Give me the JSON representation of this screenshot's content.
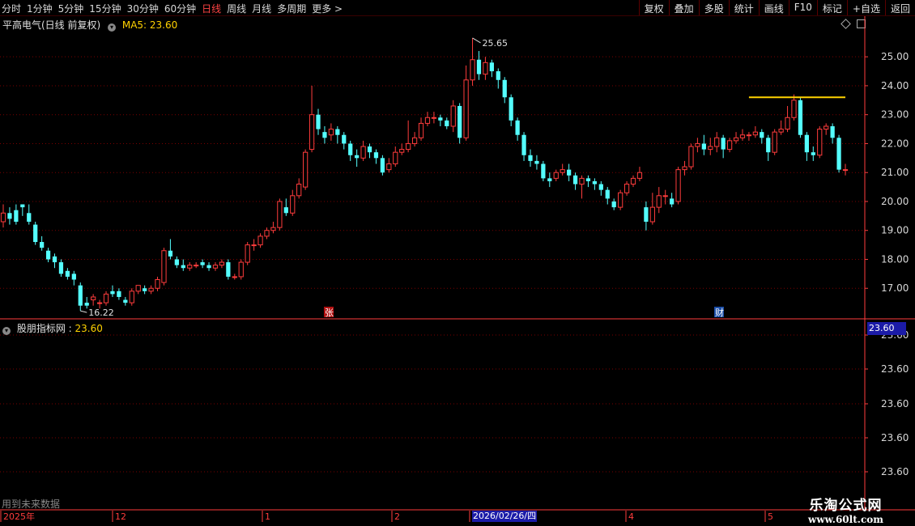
{
  "toolbar": {
    "periods": [
      "分时",
      "1分钟",
      "5分钟",
      "15分钟",
      "30分钟",
      "60分钟",
      "日线",
      "周线",
      "月线",
      "多周期",
      "更多 >"
    ],
    "active_period": "日线",
    "actions": [
      "复权",
      "叠加",
      "多股",
      "统计",
      "画线",
      "F10",
      "标记",
      "+自选",
      "返回"
    ]
  },
  "stock": {
    "name": "平高电气(日线 前复权)",
    "ma_label": "MA5: 23.60"
  },
  "indicator": {
    "name": "股朋指标网 :",
    "value": "23.60",
    "axis_labels": [
      "23.60",
      "23.60",
      "23.60",
      "23.60",
      "23.60"
    ],
    "current_tag": "23.60"
  },
  "note": "用到未来数据",
  "date_axis": {
    "labels": [
      "2025年",
      "12",
      "1",
      "2",
      "2026/02/26/四",
      "4",
      "5"
    ]
  },
  "markers": {
    "zhang": "张",
    "cai": "财"
  },
  "watermark": {
    "line1": "乐淘公式网",
    "line2": "www.60lt.com"
  },
  "colors": {
    "up": "#ff3c3c",
    "down": "#54ffff",
    "ma": "#ffd200",
    "grid": "#7a0000",
    "axis": "#ff3c3c"
  },
  "chart_data": {
    "type": "candlestick",
    "price_axis": {
      "ticks": [
        17.0,
        18.0,
        19.0,
        20.0,
        21.0,
        22.0,
        23.0,
        24.0,
        25.0
      ],
      "ylim": [
        16.0,
        25.9
      ]
    },
    "annotations": {
      "high_label": "25.65",
      "low_label": "16.22"
    },
    "ma5_level": 23.6,
    "candles": [
      [
        19.3,
        19.6,
        19.9,
        19.1
      ],
      [
        19.6,
        19.4,
        19.8,
        19.2
      ],
      [
        19.7,
        19.3,
        19.9,
        19.2
      ],
      [
        19.9,
        19.8,
        19.9,
        19.5
      ],
      [
        19.6,
        19.3,
        19.9,
        19.2
      ],
      [
        19.2,
        18.6,
        19.3,
        18.5
      ],
      [
        18.6,
        18.4,
        18.8,
        18.3
      ],
      [
        18.3,
        18.0,
        18.4,
        17.9
      ],
      [
        18.1,
        17.9,
        18.2,
        17.7
      ],
      [
        17.9,
        17.5,
        18.0,
        17.4
      ],
      [
        17.6,
        17.4,
        17.7,
        17.3
      ],
      [
        17.5,
        17.3,
        17.6,
        17.1
      ],
      [
        17.1,
        16.4,
        17.2,
        16.22
      ],
      [
        16.5,
        16.4,
        16.7,
        16.3
      ],
      [
        16.6,
        16.7,
        16.8,
        16.4
      ],
      [
        16.5,
        16.5,
        16.6,
        16.3
      ],
      [
        16.5,
        16.8,
        16.9,
        16.4
      ],
      [
        16.9,
        16.8,
        17.1,
        16.7
      ],
      [
        16.9,
        16.7,
        17.0,
        16.6
      ],
      [
        16.6,
        16.5,
        16.7,
        16.4
      ],
      [
        16.5,
        16.9,
        17.0,
        16.4
      ],
      [
        16.9,
        17.1,
        17.1,
        16.8
      ],
      [
        17.0,
        16.9,
        17.1,
        16.8
      ],
      [
        16.9,
        17.0,
        17.1,
        16.8
      ],
      [
        17.0,
        17.3,
        17.4,
        16.9
      ],
      [
        17.2,
        18.3,
        18.4,
        17.1
      ],
      [
        18.3,
        18.1,
        18.7,
        18.0
      ],
      [
        18.0,
        17.8,
        18.1,
        17.7
      ],
      [
        17.8,
        17.7,
        18.0,
        17.6
      ],
      [
        17.7,
        17.8,
        17.9,
        17.6
      ],
      [
        17.8,
        17.8,
        17.9,
        17.7
      ],
      [
        17.9,
        17.8,
        18.0,
        17.7
      ],
      [
        17.8,
        17.7,
        17.9,
        17.6
      ],
      [
        17.7,
        17.8,
        17.9,
        17.6
      ],
      [
        17.8,
        17.9,
        18.0,
        17.7
      ],
      [
        17.9,
        17.4,
        18.0,
        17.3
      ],
      [
        17.4,
        17.4,
        17.5,
        17.3
      ],
      [
        17.4,
        17.9,
        18.0,
        17.3
      ],
      [
        17.9,
        18.5,
        18.6,
        17.8
      ],
      [
        18.5,
        18.5,
        18.7,
        18.3
      ],
      [
        18.5,
        18.8,
        18.9,
        18.4
      ],
      [
        18.8,
        19.0,
        19.1,
        18.7
      ],
      [
        19.0,
        19.1,
        19.3,
        18.9
      ],
      [
        19.1,
        20.0,
        20.1,
        19.0
      ],
      [
        19.8,
        19.6,
        20.1,
        19.5
      ],
      [
        19.6,
        20.2,
        20.4,
        19.5
      ],
      [
        20.2,
        20.6,
        20.8,
        20.1
      ],
      [
        20.5,
        21.7,
        21.8,
        20.4
      ],
      [
        21.8,
        23.0,
        24.0,
        21.7
      ],
      [
        23.0,
        22.5,
        23.2,
        22.3
      ],
      [
        22.4,
        22.2,
        22.6,
        22.0
      ],
      [
        22.3,
        22.5,
        22.7,
        22.1
      ],
      [
        22.5,
        22.3,
        22.6,
        22.0
      ],
      [
        22.3,
        22.0,
        22.4,
        21.8
      ],
      [
        22.0,
        21.6,
        22.1,
        21.4
      ],
      [
        21.6,
        21.5,
        21.8,
        21.2
      ],
      [
        21.5,
        21.9,
        22.1,
        21.4
      ],
      [
        21.9,
        21.7,
        22.0,
        21.5
      ],
      [
        21.7,
        21.5,
        21.8,
        21.3
      ],
      [
        21.5,
        21.0,
        21.6,
        20.9
      ],
      [
        21.1,
        21.3,
        21.5,
        21.0
      ],
      [
        21.3,
        21.7,
        21.9,
        21.2
      ],
      [
        21.7,
        21.8,
        22.0,
        21.6
      ],
      [
        21.8,
        22.0,
        22.8,
        21.7
      ],
      [
        22.0,
        22.2,
        22.4,
        21.9
      ],
      [
        22.2,
        22.7,
        22.9,
        22.1
      ],
      [
        22.7,
        22.9,
        23.1,
        22.6
      ],
      [
        22.9,
        22.9,
        23.1,
        22.7
      ],
      [
        22.9,
        22.8,
        23.0,
        22.6
      ],
      [
        22.8,
        22.6,
        22.9,
        22.5
      ],
      [
        22.6,
        23.3,
        23.5,
        22.4
      ],
      [
        23.3,
        22.2,
        23.4,
        22.0
      ],
      [
        22.2,
        24.2,
        24.7,
        22.1
      ],
      [
        24.2,
        24.9,
        25.65,
        24.0
      ],
      [
        24.9,
        24.4,
        25.2,
        24.2
      ],
      [
        24.4,
        24.8,
        25.0,
        24.2
      ],
      [
        24.8,
        24.5,
        24.9,
        24.3
      ],
      [
        24.5,
        24.2,
        24.6,
        23.9
      ],
      [
        24.2,
        23.6,
        24.3,
        23.4
      ],
      [
        23.6,
        22.8,
        23.7,
        22.6
      ],
      [
        22.8,
        22.3,
        22.9,
        22.1
      ],
      [
        22.3,
        21.6,
        22.4,
        21.4
      ],
      [
        21.6,
        21.4,
        21.8,
        21.2
      ],
      [
        21.4,
        21.3,
        21.6,
        21.1
      ],
      [
        21.3,
        20.8,
        21.4,
        20.7
      ],
      [
        20.8,
        20.7,
        21.0,
        20.5
      ],
      [
        20.8,
        21.0,
        21.1,
        20.7
      ],
      [
        21.0,
        21.1,
        21.3,
        20.9
      ],
      [
        21.1,
        20.9,
        21.3,
        20.7
      ],
      [
        20.9,
        20.6,
        21.0,
        20.4
      ],
      [
        20.6,
        20.8,
        20.9,
        20.1
      ],
      [
        20.8,
        20.7,
        20.9,
        20.5
      ],
      [
        20.7,
        20.6,
        20.8,
        20.4
      ],
      [
        20.6,
        20.4,
        20.7,
        20.2
      ],
      [
        20.4,
        20.1,
        20.5,
        19.9
      ],
      [
        20.0,
        19.8,
        20.1,
        19.7
      ],
      [
        19.8,
        20.3,
        20.4,
        19.7
      ],
      [
        20.3,
        20.6,
        20.7,
        20.2
      ],
      [
        20.6,
        20.8,
        20.9,
        20.5
      ],
      [
        20.8,
        21.0,
        21.2,
        20.7
      ],
      [
        19.8,
        19.3,
        20.0,
        19.0
      ],
      [
        19.3,
        19.8,
        20.3,
        19.2
      ],
      [
        19.8,
        20.2,
        20.5,
        19.6
      ],
      [
        20.2,
        20.2,
        20.4,
        19.9
      ],
      [
        20.1,
        19.9,
        20.3,
        19.8
      ],
      [
        20.0,
        21.1,
        21.2,
        19.9
      ],
      [
        21.1,
        21.2,
        21.4,
        20.9
      ],
      [
        21.2,
        21.9,
        22.0,
        21.1
      ],
      [
        21.9,
        22.0,
        22.2,
        21.7
      ],
      [
        22.0,
        21.8,
        22.3,
        21.6
      ],
      [
        21.8,
        21.9,
        22.2,
        21.6
      ],
      [
        21.9,
        22.2,
        22.4,
        21.7
      ],
      [
        22.2,
        21.8,
        22.3,
        21.5
      ],
      [
        21.8,
        22.1,
        22.2,
        21.7
      ],
      [
        22.1,
        22.2,
        22.4,
        22.0
      ],
      [
        22.2,
        22.3,
        22.5,
        22.1
      ],
      [
        22.3,
        22.3,
        22.4,
        22.1
      ],
      [
        22.3,
        22.4,
        22.6,
        22.2
      ],
      [
        22.4,
        22.2,
        22.5,
        22.0
      ],
      [
        22.2,
        21.7,
        22.3,
        21.4
      ],
      [
        21.7,
        22.4,
        22.5,
        21.6
      ],
      [
        22.4,
        22.5,
        22.8,
        22.3
      ],
      [
        22.5,
        22.9,
        23.3,
        22.4
      ],
      [
        22.9,
        23.5,
        23.7,
        22.8
      ],
      [
        23.5,
        22.3,
        23.6,
        22.2
      ],
      [
        22.3,
        21.7,
        22.4,
        21.4
      ],
      [
        21.7,
        21.6,
        21.9,
        21.4
      ],
      [
        21.6,
        22.5,
        22.6,
        21.5
      ],
      [
        22.5,
        22.6,
        22.7,
        22.3
      ],
      [
        22.6,
        22.2,
        22.7,
        22.0
      ],
      [
        22.2,
        21.1,
        22.3,
        21.0
      ],
      [
        21.1,
        21.1,
        21.3,
        20.9
      ]
    ]
  }
}
